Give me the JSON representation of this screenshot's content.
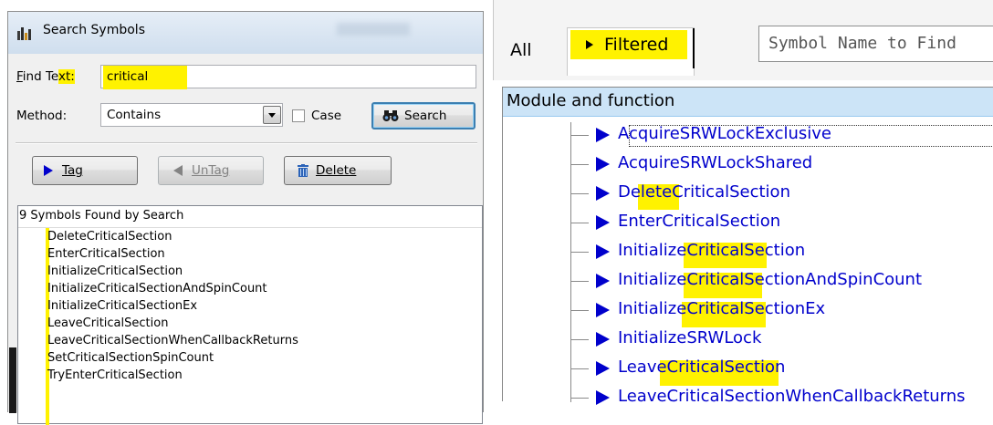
{
  "dialog": {
    "title": "Search Symbols",
    "find_text_label": "Find Text:",
    "find_text_value": "critical",
    "method_label": "Method:",
    "method_value": "Contains",
    "case_label": "Case",
    "case_checked": false,
    "search_button": "Search",
    "tag_button": "Tag",
    "untag_button": "UnTag",
    "delete_button": "Delete",
    "results_header": "9 Symbols Found by Search",
    "results": [
      "DeleteCriticalSection",
      "EnterCriticalSection",
      "InitializeCriticalSection",
      "InitializeCriticalSectionAndSpinCount",
      "InitializeCriticalSectionEx",
      "LeaveCriticalSection",
      "LeaveCriticalSectionWhenCallbackReturns",
      "SetCriticalSectionSpinCount",
      "TryEnterCriticalSection"
    ]
  },
  "panel": {
    "tab_all": "All",
    "tab_filtered": "Filtered",
    "search_placeholder": "Symbol Name to Find",
    "tree_header": "Module and function",
    "tree_items": [
      "AcquireSRWLockExclusive",
      "AcquireSRWLockShared",
      "DeleteCriticalSection",
      "EnterCriticalSection",
      "InitializeCriticalSection",
      "InitializeCriticalSectionAndSpinCount",
      "InitializeCriticalSectionEx",
      "InitializeSRWLock",
      "LeaveCriticalSection",
      "LeaveCriticalSectionWhenCallbackReturns"
    ]
  },
  "colors": {
    "highlight": "#fff200",
    "link_blue": "#0000cc",
    "header_blue": "#cce4f7",
    "title_gradient_top": "#e6eef7"
  },
  "icons": {
    "app": "app-icon",
    "binoculars": "binoculars-icon",
    "play": "play-arrow-icon",
    "back": "back-arrow-icon",
    "trash": "trash-icon",
    "dropdown": "dropdown-arrow-icon"
  }
}
